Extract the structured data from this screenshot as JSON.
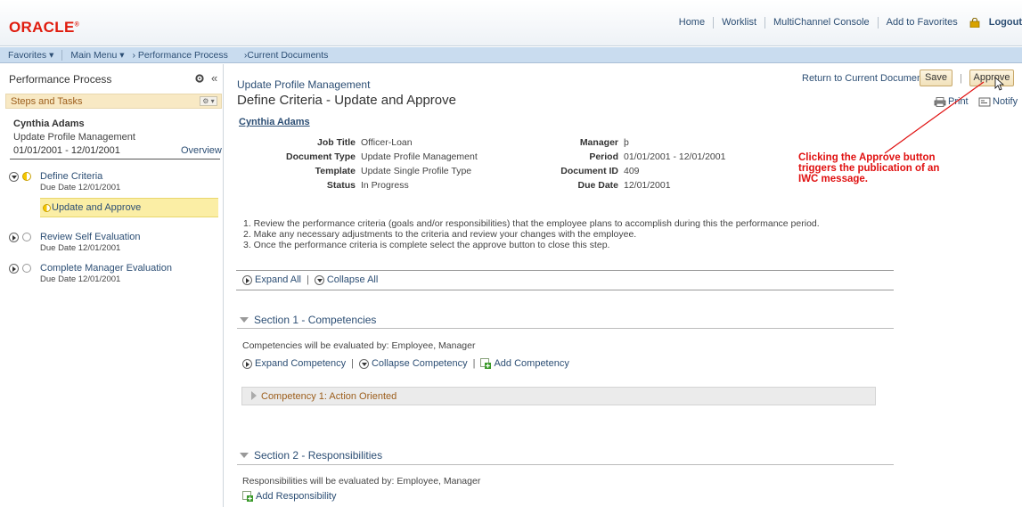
{
  "header": {
    "logo": "ORACLE",
    "links": [
      "Home",
      "Worklist",
      "MultiChannel Console",
      "Add to Favorites"
    ],
    "logout": "Logout"
  },
  "nav": {
    "favorites": "Favorites ▾",
    "main_menu": "Main Menu ▾",
    "crumb1": "› Performance Process",
    "crumb2": "›Current Documents"
  },
  "left": {
    "title": "Performance Process",
    "steps_title": "Steps and Tasks",
    "employee": "Cynthia Adams",
    "doc_type": "Update Profile Management",
    "dates": "01/01/2001  -  12/01/2001",
    "overview": "Overview",
    "steps": [
      {
        "label": "Define Criteria",
        "due": "Due Date   12/01/2001"
      },
      {
        "label": "Review Self Evaluation",
        "due": "Due Date   12/01/2001"
      },
      {
        "label": "Complete Manager Evaluation",
        "due": "Due Date   12/01/2001"
      }
    ],
    "substep": "Update and Approve"
  },
  "main": {
    "page_label": "Update Profile Management",
    "title": "Define Criteria - Update and Approve",
    "return_link": "Return to Current Documents",
    "save": "Save",
    "sep": "|",
    "approve": "Approve",
    "print": "Print",
    "notify": "Notify",
    "employee": "Cynthia Adams",
    "fields_left": [
      {
        "label": "Job Title",
        "value": "Officer-Loan"
      },
      {
        "label": "Document Type",
        "value": "Update Profile Management"
      },
      {
        "label": "Template",
        "value": "Update Single Profile Type"
      },
      {
        "label": "Status",
        "value": "In Progress"
      }
    ],
    "fields_right": [
      {
        "label": "Manager",
        "value": "þ"
      },
      {
        "label": "Period",
        "value": "01/01/2001  -  12/01/2001"
      },
      {
        "label": "Document ID",
        "value": "409"
      },
      {
        "label": "Due Date",
        "value": "12/01/2001"
      }
    ],
    "annotation": [
      "Clicking the Approve button",
      "triggers the publication of an",
      "IWC message."
    ],
    "instructions": [
      "1.  Review the performance criteria (goals and/or responsibilities) that the employee plans to accomplish during this the performance period.",
      "2.  Make any necessary adjustments to the criteria and review your changes with the employee.",
      "3.  Once the performance criteria is complete select the approve button to close this step."
    ],
    "expand_all": "Expand All",
    "collapse_all": "Collapse All",
    "section1": {
      "title": "Section 1 - Competencies",
      "evaluated_by": "Competencies will be evaluated by: Employee, Manager",
      "expand": "Expand Competency",
      "collapse": "Collapse Competency",
      "add": "Add Competency",
      "competency": "Competency 1: Action Oriented"
    },
    "section2": {
      "title": "Section 2 - Responsibilities",
      "evaluated_by": "Responsibilities will be evaluated by: Employee, Manager",
      "add": "Add Responsibility"
    },
    "pipe": "|"
  },
  "colors": {
    "brand_red": "#e01c0e",
    "link_blue": "#2c4e74",
    "annotation_red": "#e01010",
    "highlight_yellow": "#fbeea5"
  }
}
